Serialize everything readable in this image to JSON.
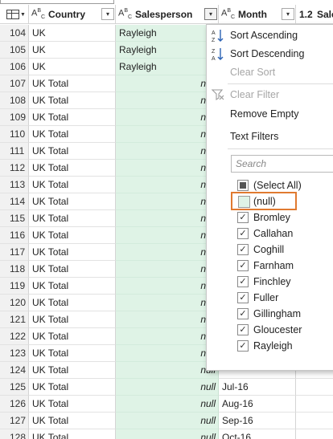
{
  "header": {
    "country_label": "Country",
    "salesperson_label": "Salesperson",
    "month_label": "Month",
    "next_label": "Sale",
    "next_type": "1.2"
  },
  "rows": [
    {
      "num": "104",
      "country": "UK",
      "salesperson": "Rayleigh",
      "month": ""
    },
    {
      "num": "105",
      "country": "UK",
      "salesperson": "Rayleigh",
      "month": ""
    },
    {
      "num": "106",
      "country": "UK",
      "salesperson": "Rayleigh",
      "month": ""
    },
    {
      "num": "107",
      "country": "UK Total",
      "salesperson": "null",
      "month": ""
    },
    {
      "num": "108",
      "country": "UK Total",
      "salesperson": "null",
      "month": ""
    },
    {
      "num": "109",
      "country": "UK Total",
      "salesperson": "null",
      "month": ""
    },
    {
      "num": "110",
      "country": "UK Total",
      "salesperson": "null",
      "month": ""
    },
    {
      "num": "111",
      "country": "UK Total",
      "salesperson": "null",
      "month": ""
    },
    {
      "num": "112",
      "country": "UK Total",
      "salesperson": "null",
      "month": ""
    },
    {
      "num": "113",
      "country": "UK Total",
      "salesperson": "null",
      "month": ""
    },
    {
      "num": "114",
      "country": "UK Total",
      "salesperson": "null",
      "month": ""
    },
    {
      "num": "115",
      "country": "UK Total",
      "salesperson": "null",
      "month": ""
    },
    {
      "num": "116",
      "country": "UK Total",
      "salesperson": "null",
      "month": ""
    },
    {
      "num": "117",
      "country": "UK Total",
      "salesperson": "null",
      "month": ""
    },
    {
      "num": "118",
      "country": "UK Total",
      "salesperson": "null",
      "month": ""
    },
    {
      "num": "119",
      "country": "UK Total",
      "salesperson": "null",
      "month": ""
    },
    {
      "num": "120",
      "country": "UK Total",
      "salesperson": "null",
      "month": ""
    },
    {
      "num": "121",
      "country": "UK Total",
      "salesperson": "null",
      "month": ""
    },
    {
      "num": "122",
      "country": "UK Total",
      "salesperson": "null",
      "month": ""
    },
    {
      "num": "123",
      "country": "UK Total",
      "salesperson": "null",
      "month": ""
    },
    {
      "num": "124",
      "country": "UK Total",
      "salesperson": "null",
      "month": ""
    },
    {
      "num": "125",
      "country": "UK Total",
      "salesperson": "null",
      "month": "Jul-16"
    },
    {
      "num": "126",
      "country": "UK Total",
      "salesperson": "null",
      "month": "Aug-16"
    },
    {
      "num": "127",
      "country": "UK Total",
      "salesperson": "null",
      "month": "Sep-16"
    },
    {
      "num": "128",
      "country": "UK Total",
      "salesperson": "null",
      "month": "Oct-16"
    }
  ],
  "menu": {
    "sort_asc": "Sort Ascending",
    "sort_desc": "Sort Descending",
    "clear_sort": "Clear Sort",
    "clear_filter": "Clear Filter",
    "remove_empty": "Remove Empty",
    "text_filters": "Text Filters",
    "search_placeholder": "Search",
    "select_all": "(Select All)",
    "null_item": "(null)",
    "items": [
      "Bromley",
      "Callahan",
      "Coghill",
      "Farnham",
      "Finchley",
      "Fuller",
      "Gillingham",
      "Gloucester",
      "Rayleigh"
    ]
  },
  "colors": {
    "selected_column": "#dff3e6",
    "highlight_border": "#e07a30"
  }
}
